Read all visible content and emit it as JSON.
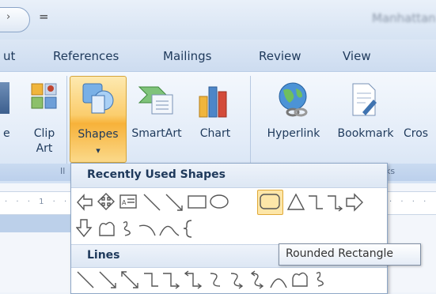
{
  "window": {
    "doc_title": "Manhattan"
  },
  "quick_access": {
    "dropdown_glyph": "="
  },
  "tabs": [
    {
      "label": "ut"
    },
    {
      "label": "References"
    },
    {
      "label": "Mailings"
    },
    {
      "label": "Review"
    },
    {
      "label": "View"
    }
  ],
  "ribbon": {
    "partial_left_label": "e",
    "clip_art": {
      "line1": "Clip",
      "line2": "Art"
    },
    "shapes": {
      "label": "Shapes",
      "arrow": "▾"
    },
    "smartart": {
      "label": "SmartArt"
    },
    "chart": {
      "label": "Chart"
    },
    "hyperlink": {
      "label": "Hyperlink"
    },
    "bookmark": {
      "label": "Bookmark"
    },
    "cross": {
      "label": "Cros"
    },
    "group_left": "Il",
    "group_links": "ks"
  },
  "dropdown": {
    "recent_header": "Recently Used Shapes",
    "lines_header": "Lines",
    "recent_row1": [
      "left-arrow-shape",
      "four-way-arrow-shape",
      "text-box-shape",
      "line-shape",
      "arrow-line-shape",
      "rectangle-shape",
      "oval-shape",
      "rounded-rectangle-shape",
      "triangle-shape",
      "elbow-connector-shape",
      "elbow-arrow-connector-shape",
      "right-arrow-shape"
    ],
    "recent_row2": [
      "down-arrow-shape",
      "freeform-shape",
      "scribble-shape",
      "arc-shape",
      "curve-shape",
      "left-brace-shape"
    ],
    "lines_row": [
      "line-shape",
      "arrow-line-shape",
      "double-arrow-line-shape",
      "elbow-connector-shape",
      "elbow-arrow-connector-shape",
      "elbow-double-arrow-connector-shape",
      "curved-connector-shape",
      "curved-arrow-connector-shape",
      "curved-double-arrow-connector-shape",
      "curve-shape",
      "freeform-shape",
      "scribble-shape"
    ]
  },
  "tooltip": {
    "text": "Rounded Rectangle"
  },
  "colors": {
    "accent_orange": "#f7b23a",
    "ribbon_text": "#1e395b",
    "selection": "#fde6a8"
  }
}
